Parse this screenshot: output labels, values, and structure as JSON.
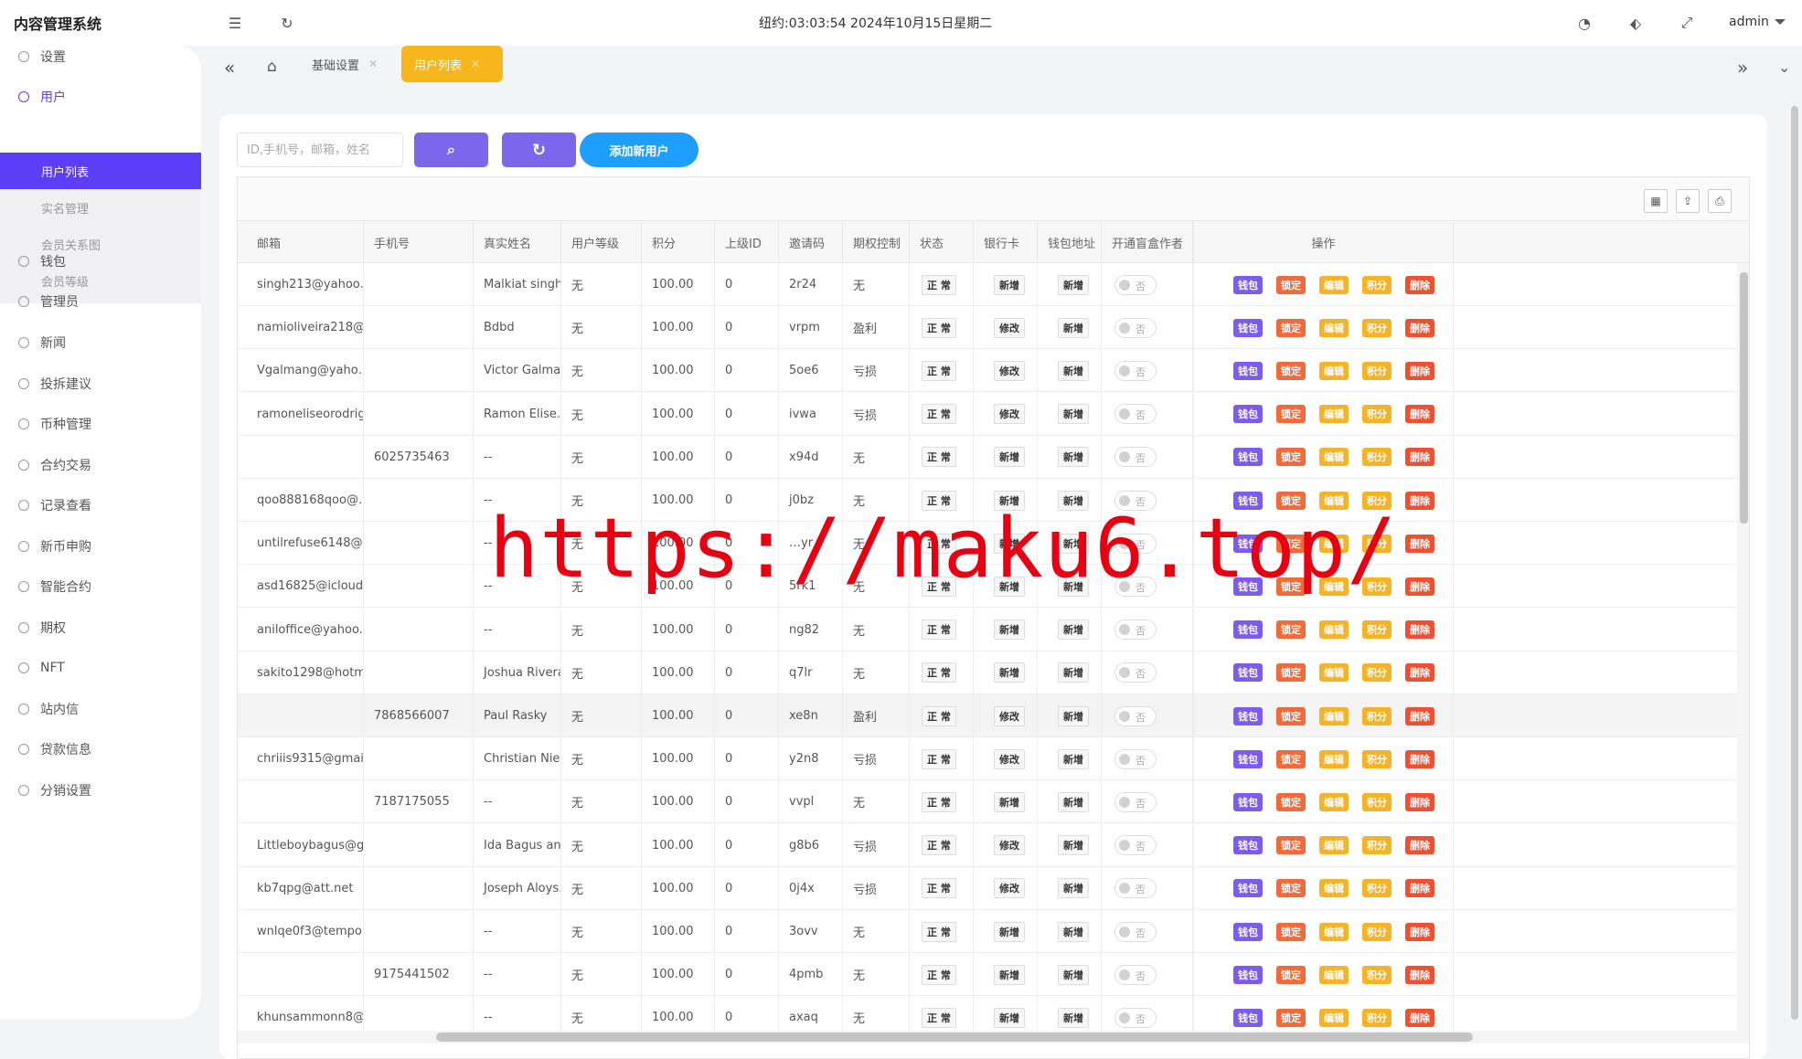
{
  "app": {
    "title": "内容管理系统",
    "clock": "纽约:03:03:54 2024年10月15日星期二",
    "user": "admin"
  },
  "sidebar": {
    "items": [
      {
        "label": "设置",
        "icon": "gear-icon"
      },
      {
        "label": "用户",
        "icon": "user-icon"
      },
      {
        "label": "钱包",
        "icon": "dollar-icon"
      },
      {
        "label": "管理员",
        "icon": "shield-icon"
      },
      {
        "label": "新闻",
        "icon": "tag-icon"
      },
      {
        "label": "投拆建议",
        "icon": "link-icon"
      },
      {
        "label": "币种管理",
        "icon": "diamond-icon"
      },
      {
        "label": "合约交易",
        "icon": "diamond-icon"
      },
      {
        "label": "记录查看",
        "icon": "record-icon"
      },
      {
        "label": "新币申购",
        "icon": "dollar-icon"
      },
      {
        "label": "智能合约",
        "icon": "contract-icon"
      },
      {
        "label": "期权",
        "icon": "option-icon"
      },
      {
        "label": "NFT",
        "icon": "nft-icon"
      },
      {
        "label": "站内信",
        "icon": "bell-icon"
      },
      {
        "label": "贷款信息",
        "icon": "document-icon"
      },
      {
        "label": "分销设置",
        "icon": "gear-icon"
      }
    ],
    "submenu": [
      "用户列表",
      "实名管理",
      "会员关系图",
      "会员等级"
    ]
  },
  "tabs": [
    {
      "label": "基础设置"
    },
    {
      "label": "用户列表"
    }
  ],
  "toolbar": {
    "search_placeholder": "ID,手机号，邮箱，姓名",
    "add_label": "添加新用户"
  },
  "table": {
    "columns": [
      "邮箱",
      "手机号",
      "真实姓名",
      "用户等级",
      "积分",
      "上级ID",
      "邀请码",
      "期权控制",
      "状态",
      "银行卡",
      "钱包地址",
      "开通盲盒作者",
      "操作"
    ],
    "ops": [
      "钱包",
      "锁定",
      "编辑",
      "积分",
      "删除"
    ],
    "toggle_label": "否",
    "rows": [
      [
        "singh213@yahoo.…",
        "",
        "Malkiat singh",
        "无",
        "100.00",
        "0",
        "2r24",
        "无",
        "正 常",
        "新增",
        "新增"
      ],
      [
        "namioliveira218@…",
        "",
        "Bdbd",
        "无",
        "100.00",
        "0",
        "vrpm",
        "盈利",
        "正 常",
        "修改",
        "新增"
      ],
      [
        "Vgalmang@yaho…",
        "",
        "Victor Galman",
        "无",
        "100.00",
        "0",
        "5oe6",
        "亏损",
        "正 常",
        "修改",
        "新增"
      ],
      [
        "ramoneliseorodrig…",
        "",
        "Ramon Elise…",
        "无",
        "100.00",
        "0",
        "ivwa",
        "亏损",
        "正 常",
        "修改",
        "新增"
      ],
      [
        "",
        "6025735463",
        "--",
        "无",
        "100.00",
        "0",
        "x94d",
        "无",
        "正 常",
        "新增",
        "新增"
      ],
      [
        "qoo888168qoo@…",
        "",
        "--",
        "无",
        "100.00",
        "0",
        "j0bz",
        "无",
        "正 常",
        "新增",
        "新增"
      ],
      [
        "untilrefuse6148@…",
        "",
        "--",
        "无",
        "100.00",
        "0",
        "…yr",
        "无",
        "正 常",
        "新增",
        "新增"
      ],
      [
        "asd16825@icloud…",
        "",
        "--",
        "无",
        "100.00",
        "0",
        "5rk1",
        "无",
        "正 常",
        "新增",
        "新增"
      ],
      [
        "aniloffice@yahoo.…",
        "",
        "--",
        "无",
        "100.00",
        "0",
        "ng82",
        "无",
        "正 常",
        "新增",
        "新增"
      ],
      [
        "sakito1298@hotm…",
        "",
        "Joshua Rivera",
        "无",
        "100.00",
        "0",
        "q7lr",
        "无",
        "正 常",
        "新增",
        "新增"
      ],
      [
        "",
        "7868566007",
        "Paul Rasky",
        "无",
        "100.00",
        "0",
        "xe8n",
        "盈利",
        "正 常",
        "修改",
        "新增"
      ],
      [
        "chriiis9315@gmail…",
        "",
        "Christian Nie…",
        "无",
        "100.00",
        "0",
        "y2n8",
        "亏损",
        "正 常",
        "修改",
        "新增"
      ],
      [
        "",
        "7187175055",
        "--",
        "无",
        "100.00",
        "0",
        "vvpl",
        "无",
        "正 常",
        "新增",
        "新增"
      ],
      [
        "Littleboybagus@g…",
        "",
        "Ida Bagus an…",
        "无",
        "100.00",
        "0",
        "g8b6",
        "亏损",
        "正 常",
        "修改",
        "新增"
      ],
      [
        "kb7qpg@att.net",
        "",
        "Joseph Aloys…",
        "无",
        "100.00",
        "0",
        "0j4x",
        "亏损",
        "正 常",
        "修改",
        "新增"
      ],
      [
        "wnlqe0f3@tempor…",
        "",
        "--",
        "无",
        "100.00",
        "0",
        "3ovv",
        "无",
        "正 常",
        "新增",
        "新增"
      ],
      [
        "",
        "9175441502",
        "--",
        "无",
        "100.00",
        "0",
        "4pmb",
        "无",
        "正 常",
        "新增",
        "新增"
      ],
      [
        "khunsammonn8@…",
        "",
        "--",
        "无",
        "100.00",
        "0",
        "axaq",
        "无",
        "正 常",
        "新增",
        "新增"
      ]
    ]
  },
  "watermark": "https://maku6.top/",
  "colors": {
    "accent": "#5b3ef5",
    "tab_active": "#f6b61c",
    "add_button": "#1e9fff",
    "op_wallet": "#7c5cf0",
    "op_lock": "#f06a3a",
    "op_edit": "#f5b325",
    "op_points": "#f5b325",
    "op_delete": "#f05030"
  }
}
